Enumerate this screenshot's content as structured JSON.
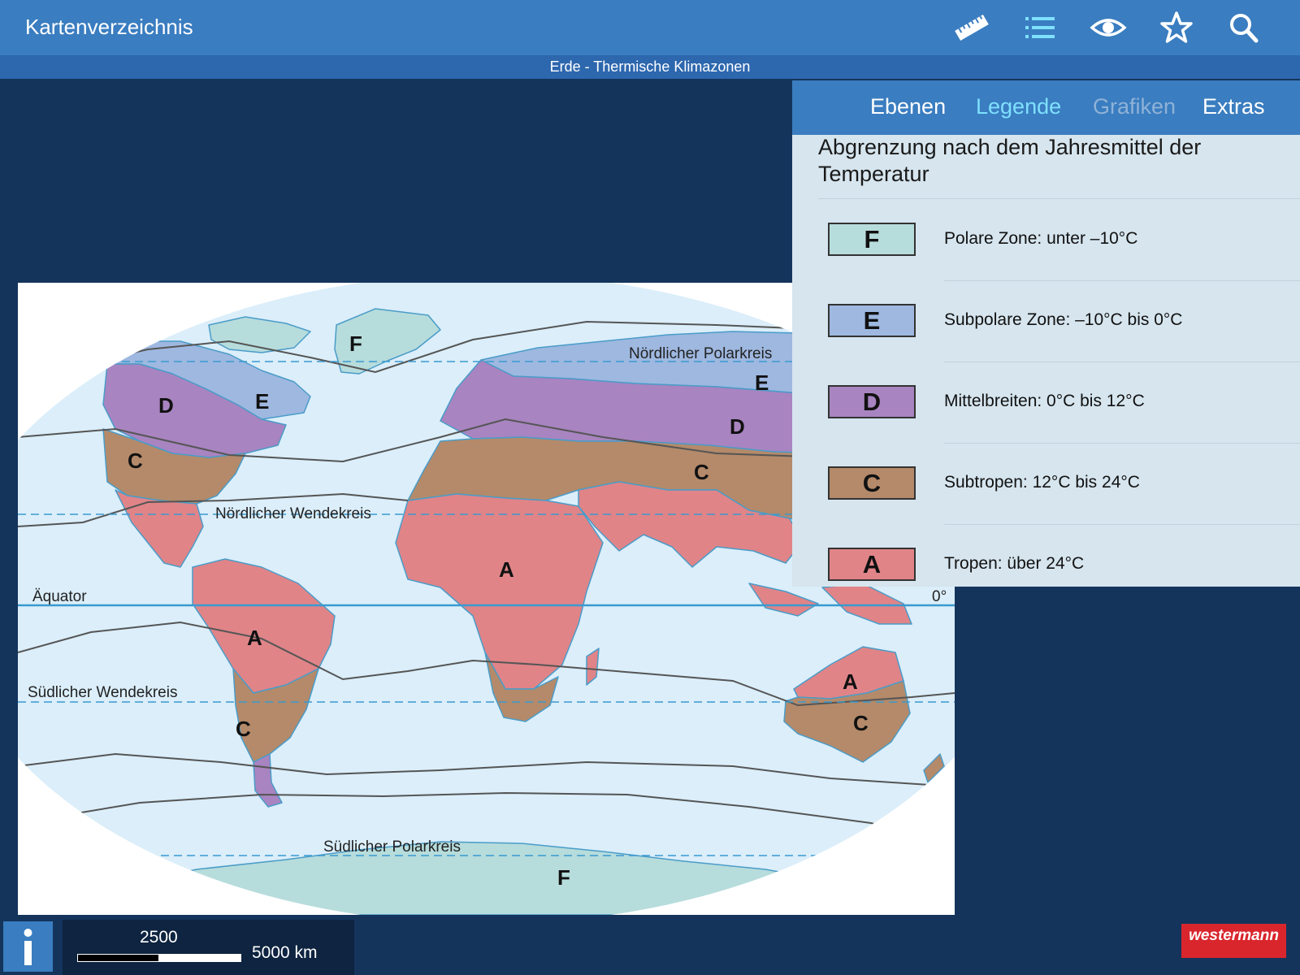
{
  "header": {
    "title": "Kartenverzeichnis",
    "icons": [
      "ruler-icon",
      "list-icon",
      "eye-icon",
      "star-icon",
      "search-icon"
    ]
  },
  "map": {
    "title": "Erde - Thermische Klimazonen",
    "labels": {
      "n_polar": "Nördlicher Polarkreis",
      "n_tropic": "Nördlicher Wendekreis",
      "equator": "Äquator",
      "zero_deg": "0°",
      "s_tropic": "Südlicher Wendekreis",
      "s_polar": "Südlicher Polarkreis"
    },
    "zones": {
      "f": "F",
      "e": "E",
      "d": "D",
      "c": "C",
      "a": "A"
    }
  },
  "panel": {
    "tabs": [
      {
        "label": "Ebenen",
        "state": "normal"
      },
      {
        "label": "Legende",
        "state": "active"
      },
      {
        "label": "Grafiken",
        "state": "disabled"
      },
      {
        "label": "Extras",
        "state": "normal"
      }
    ],
    "heading": "Abgrenzung nach dem Jahresmittel der Temperatur",
    "legend": [
      {
        "code": "F",
        "text": "Polare Zone: unter –10°C",
        "color": "#b7dcdc"
      },
      {
        "code": "E",
        "text": "Subpolare Zone: –10°C bis 0°C",
        "color": "#9eb8e0"
      },
      {
        "code": "D",
        "text": "Mittelbreiten: 0°C bis 12°C",
        "color": "#a884c0"
      },
      {
        "code": "C",
        "text": "Subtropen: 12°C bis 24°C",
        "color": "#b48a6a"
      },
      {
        "code": "A",
        "text": "Tropen: über 24°C",
        "color": "#e08488"
      }
    ]
  },
  "scale": {
    "mid": "2500",
    "end": "5000 km"
  },
  "footer": {
    "logo": "westermann"
  },
  "colors": {
    "topbar": "#3a7dc0",
    "active_tab": "#7fe0ff",
    "ocean": "#dbeefa",
    "background": "#14345c"
  }
}
